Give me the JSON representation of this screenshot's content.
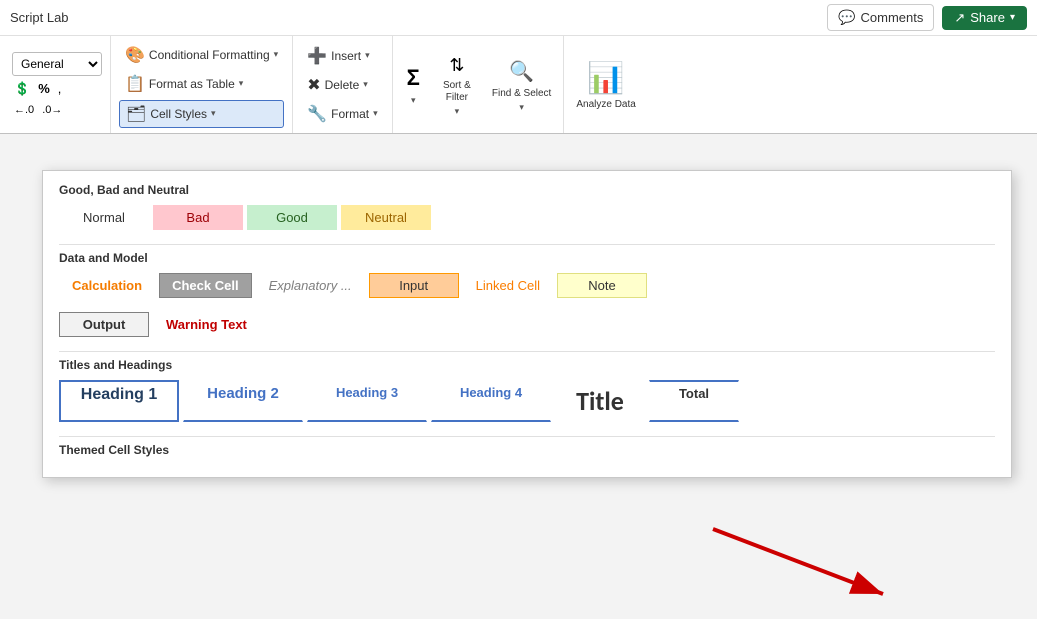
{
  "titlebar": {
    "app_name": "Script Lab",
    "comments_label": "Comments",
    "share_label": "Share"
  },
  "ribbon": {
    "num_format": "General",
    "conditional_formatting": "Conditional Formatting",
    "format_as_table": "Format as Table",
    "cell_styles": "Cell Styles",
    "insert": "Insert",
    "delete": "Delete",
    "format": "Format",
    "sort_filter": "Sort & Filter",
    "find_select": "Find & Select",
    "analyze_data": "Analyze Data"
  },
  "popup": {
    "section1_title": "Good, Bad and Neutral",
    "section2_title": "Data and Model",
    "section3_title": "Titles and Headings",
    "section4_title": "Themed Cell Styles",
    "styles_gbn": [
      {
        "label": "Normal",
        "class": "style-normal"
      },
      {
        "label": "Bad",
        "class": "style-bad"
      },
      {
        "label": "Good",
        "class": "style-good"
      },
      {
        "label": "Neutral",
        "class": "style-neutral"
      }
    ],
    "styles_dm": [
      {
        "label": "Calculation",
        "class": "style-calc"
      },
      {
        "label": "Check Cell",
        "class": "style-check"
      },
      {
        "label": "Explanatory ...",
        "class": "style-explanatory"
      },
      {
        "label": "Input",
        "class": "style-input"
      },
      {
        "label": "Linked Cell",
        "class": "style-linked"
      },
      {
        "label": "Note",
        "class": "style-note"
      },
      {
        "label": "Output",
        "class": "style-output"
      },
      {
        "label": "Warning Text",
        "class": "style-warning"
      }
    ],
    "styles_th": [
      {
        "label": "Heading 1",
        "class": "style-h1"
      },
      {
        "label": "Heading 2",
        "class": "style-h2"
      },
      {
        "label": "Heading 3",
        "class": "style-h3"
      },
      {
        "label": "Heading 4",
        "class": "style-h4"
      },
      {
        "label": "Title",
        "class": "style-title"
      },
      {
        "label": "Total",
        "class": "style-total"
      }
    ]
  },
  "icons": {
    "comment": "💬",
    "share": "↗",
    "cond_fmt": "🎨",
    "fmt_table": "📋",
    "cell_styles": "🗂",
    "insert": "➕",
    "delete": "✖",
    "format": "🔧",
    "sum": "Σ",
    "sort": "⇅",
    "magnify": "🔍",
    "analyze": "📊",
    "percent": "%",
    "comma": ",",
    "inc_dec": "⇵"
  }
}
